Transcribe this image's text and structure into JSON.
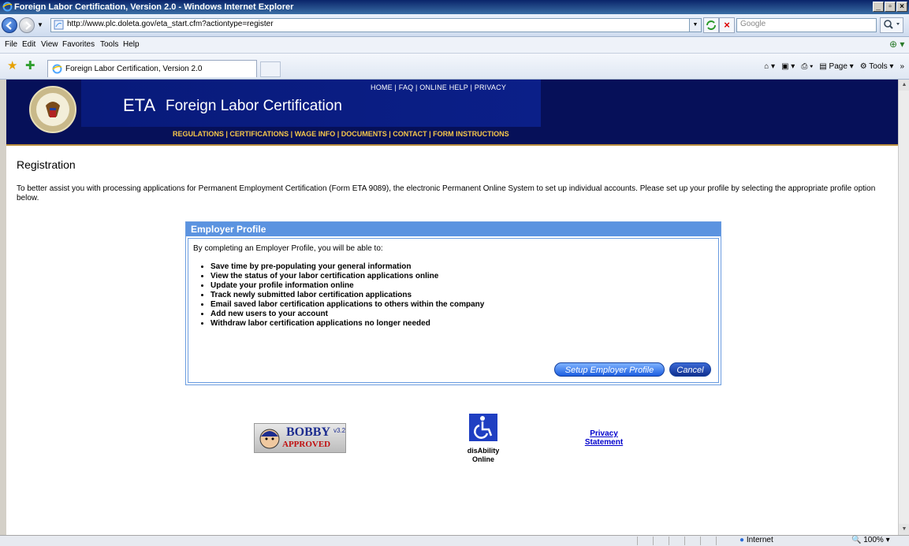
{
  "window": {
    "title": "Foreign Labor Certification, Version 2.0 - Windows Internet Explorer"
  },
  "address": {
    "url": "http://www.plc.doleta.gov/eta_start.cfm?actiontype=register"
  },
  "search": {
    "placeholder": "Google"
  },
  "menu": {
    "file": "File",
    "edit": "Edit",
    "view": "View",
    "favorites": "Favorites",
    "tools": "Tools",
    "help": "Help"
  },
  "tab": {
    "label": "Foreign Labor Certification, Version 2.0"
  },
  "commandbar": {
    "page": "Page",
    "tools": "Tools"
  },
  "header": {
    "eta": "ETA",
    "title": "Foreign Labor Certification",
    "top_links": "HOME | FAQ | ONLINE HELP | PRIVACY",
    "bottom_links": "REGULATIONS | CERTIFICATIONS | WAGE INFO | DOCUMENTS | CONTACT | FORM INSTRUCTIONS"
  },
  "page": {
    "heading": "Registration",
    "intro": "To better assist you with processing applications for Permanent Employment Certification (Form ETA 9089), the electronic Permanent Online System to set up individual accounts. Please set up your profile by selecting the appropriate profile option below."
  },
  "panel": {
    "title": "Employer Profile",
    "lead": "By completing an Employer Profile, you will be able to:",
    "items": [
      "Save time by pre-populating your general information",
      "View the status of your labor certification applications online",
      "Update your profile information online",
      "Track newly submitted labor certification applications",
      "Email saved labor certification applications to others within the company",
      "Add new users to your account",
      "Withdraw labor certification applications no longer needed"
    ],
    "setup_label": "Setup Employer Profile",
    "cancel_label": "Cancel"
  },
  "footer": {
    "bobby_top": "BOBBY",
    "bobby_version": "v3.2",
    "bobby_bottom": "APPROVED",
    "disability_line1": "disAbility",
    "disability_line2": "Online",
    "privacy_line1": "Privacy",
    "privacy_line2": "Statement"
  },
  "status": {
    "zone": "Internet",
    "zoom": "100%"
  }
}
